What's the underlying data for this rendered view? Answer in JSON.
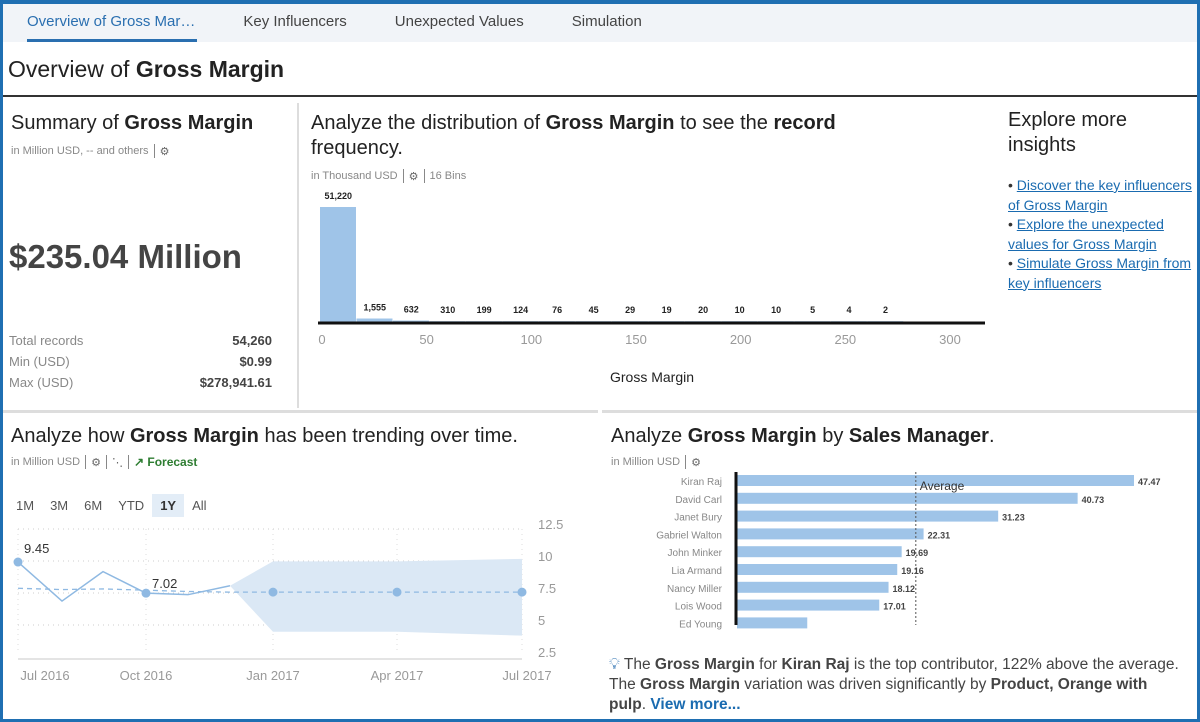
{
  "tabs": [
    {
      "label": "Overview of Gross Mar…",
      "active": true
    },
    {
      "label": "Key Influencers"
    },
    {
      "label": "Unexpected Values"
    },
    {
      "label": "Simulation"
    }
  ],
  "page_title": {
    "pre": "Overview of ",
    "bold": "Gross Margin"
  },
  "summary": {
    "title_pre": "Summary of ",
    "title_bold": "Gross Margin",
    "unit": "in Million USD, -- and others",
    "value": "$235.04 Million",
    "stats": [
      {
        "label": "Total records",
        "value": "54,260"
      },
      {
        "label": "Min (USD)",
        "value": "$0.99"
      },
      {
        "label": "Max (USD)",
        "value": "$278,941.61"
      }
    ]
  },
  "distribution": {
    "title": [
      "Analyze the distribution of ",
      "Gross Margin",
      " to see the ",
      "record",
      " frequency."
    ],
    "unit": "in Thousand USD",
    "bins_label": "16 Bins"
  },
  "explore": {
    "title": "Explore more insights",
    "links": [
      {
        "text": "Discover the key influencers of Gross Margin"
      },
      {
        "text": "Explore the unexpected values for Gross Margin"
      },
      {
        "text": "Simulate Gross Margin from key influencers"
      }
    ]
  },
  "trend": {
    "title": [
      "Analyze how ",
      "Gross Margin",
      " has been trending over time."
    ],
    "unit": "in Million USD",
    "forecast_label": "Forecast",
    "ranges": [
      {
        "label": "1M"
      },
      {
        "label": "3M"
      },
      {
        "label": "6M"
      },
      {
        "label": "YTD"
      },
      {
        "label": "1Y",
        "selected": true
      },
      {
        "label": "All"
      }
    ]
  },
  "by_manager": {
    "title": [
      "Analyze ",
      "Gross Margin",
      " by ",
      "Sales Manager",
      "."
    ],
    "unit": "in Million USD",
    "insight": {
      "t1": "The ",
      "b1": "Gross Margin",
      "t2": " for ",
      "b2": "Kiran Raj",
      "t3": " is the top contributor, 122% above the average. The ",
      "b3": "Gross Margin",
      "t4": " variation was driven significantly by ",
      "b4": "Product, Orange with pulp",
      "t5": ". ",
      "link": "View more..."
    }
  },
  "colors": {
    "accent": "#2a6fb0",
    "bar": "#9fc4e8",
    "forecast_band": "#dbe8f5",
    "forecast": "#2e7d32",
    "frame": "#1f6fb2"
  },
  "chart_data": [
    {
      "type": "bar",
      "name": "distribution",
      "xlabel": "Gross Margin",
      "xlim": [
        0,
        300
      ],
      "xticks": [
        0,
        50,
        100,
        150,
        200,
        250,
        300
      ],
      "bin_width": 17.43,
      "values": [
        51220,
        1555,
        632,
        310,
        199,
        124,
        76,
        45,
        29,
        19,
        20,
        10,
        10,
        5,
        4,
        2
      ],
      "labels": [
        "51,220",
        "1,555",
        "632",
        "310",
        "199",
        "124",
        "76",
        "45",
        "29",
        "19",
        "20",
        "10",
        "10",
        "5",
        "4",
        "2"
      ]
    },
    {
      "type": "line",
      "name": "trend",
      "ylim": [
        2.5,
        12.5
      ],
      "yticks": [
        "12.5",
        "10",
        "7.5",
        "5",
        "2.5"
      ],
      "xticks": [
        "Jul 2016",
        "Oct 2016",
        "Jan 2017",
        "Apr 2017",
        "Jul 2017"
      ],
      "actual": [
        {
          "x": "Jul 2016",
          "y": 9.45,
          "label": "9.45"
        },
        {
          "x": "Aug 2016",
          "y": 6.4
        },
        {
          "x": "Sep 2016",
          "y": 8.7
        },
        {
          "x": "Oct 2016",
          "y": 7.02,
          "label": "7.02"
        },
        {
          "x": "Nov 2016",
          "y": 6.9
        },
        {
          "x": "Dec 2016",
          "y": 7.6
        }
      ],
      "trendline": [
        7.4,
        7.3,
        7.35,
        7.25,
        7.15,
        7.1
      ],
      "forecast": [
        {
          "x": "Jan 2017",
          "y": 7.1,
          "low": 4.0,
          "high": 9.5
        },
        {
          "x": "Apr 2017",
          "y": 7.1,
          "low": 4.0,
          "high": 9.5
        },
        {
          "x": "Jul 2017",
          "y": 7.1,
          "low": 3.7,
          "high": 9.7
        }
      ]
    },
    {
      "type": "bar",
      "name": "by_manager",
      "orientation": "horizontal",
      "average_label": "Average",
      "average": 21.5,
      "categories": [
        "Kiran Raj",
        "David Carl",
        "Janet Bury",
        "Gabriel Walton",
        "John Minker",
        "Lia Armand",
        "Nancy Miller",
        "Lois Wood",
        "Ed Young"
      ],
      "values": [
        47.47,
        40.73,
        31.23,
        22.31,
        19.69,
        19.16,
        18.12,
        17.01,
        8.4
      ],
      "labels": [
        "47.47",
        "40.73",
        "31.23",
        "22.31",
        "19.69",
        "19.16",
        "18.12",
        "17.01",
        ""
      ]
    }
  ]
}
